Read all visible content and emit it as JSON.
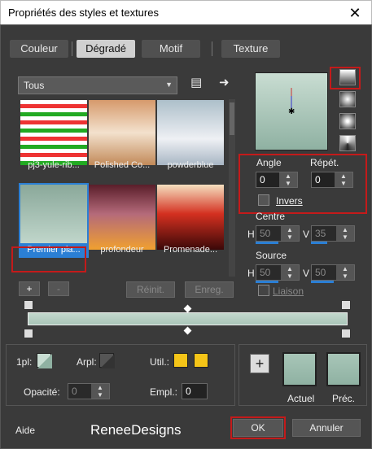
{
  "window": {
    "title": "Propriétés des styles et textures",
    "close": "✕"
  },
  "tabs": [
    {
      "label": "Couleur",
      "active": false
    },
    {
      "label": "Dégradé",
      "active": true
    },
    {
      "label": "Motif",
      "active": false
    },
    {
      "label": "Texture",
      "active": false
    }
  ],
  "category": {
    "selected": "Tous"
  },
  "thumbnails": [
    {
      "label": "pj3-yule-rib...",
      "selected": false
    },
    {
      "label": "Polished Co...",
      "selected": false
    },
    {
      "label": "powderblue",
      "selected": false
    },
    {
      "label": "Premier pla...",
      "selected": true
    },
    {
      "label": "profondeur",
      "selected": false
    },
    {
      "label": "Promenade...",
      "selected": false
    }
  ],
  "angle": {
    "label": "Angle",
    "value": "0"
  },
  "repeat": {
    "label": "Répét.",
    "value": "0"
  },
  "invert": {
    "label": "Invers",
    "checked": false
  },
  "center": {
    "label": "Centre",
    "h_label": "H",
    "h_value": "50",
    "v_label": "V",
    "v_value": "35"
  },
  "source": {
    "label": "Source",
    "h_label": "H",
    "h_value": "50",
    "v_label": "V",
    "v_value": "50"
  },
  "link": {
    "label": "Liaison",
    "checked": false
  },
  "editor": {
    "add": "+",
    "remove": "-",
    "reset": "Réinit.",
    "save": "Enreg."
  },
  "bottom": {
    "opl_label": "1pl:",
    "arpl_label": "Arpl:",
    "util_label": "Util.:",
    "opacity_label": "Opacité:",
    "opacity_value": "0",
    "empl_label": "Empl.:",
    "empl_value": "0",
    "add_button": "+",
    "current_label": "Actuel",
    "previous_label": "Préc."
  },
  "footer": {
    "help": "Aide",
    "watermark": "ReneeDesigns",
    "ok": "OK",
    "cancel": "Annuler"
  },
  "colors": {
    "accent": "#2b7fd4",
    "highlight": "#c41a1a",
    "gradient_light": "#c9ddd2",
    "gradient_dark": "#8fb1a2",
    "util_swatch": "#f5c518"
  }
}
